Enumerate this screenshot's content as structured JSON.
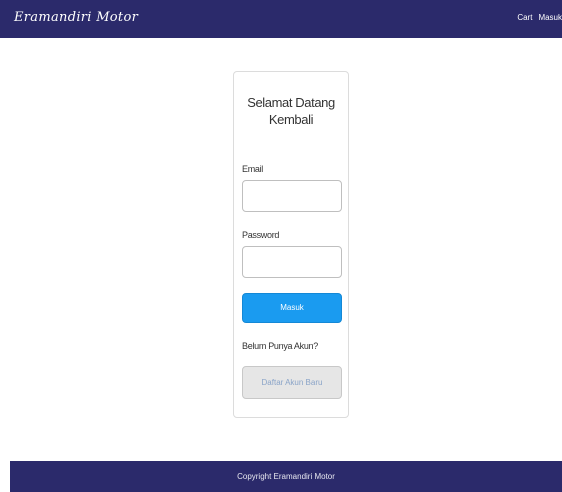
{
  "navbar": {
    "brand": "Eramandiri Motor",
    "links": [
      "Cart",
      "Masuk"
    ]
  },
  "login": {
    "title_line1": "Selamat Datang",
    "title_line2": "Kembali",
    "email_label": "Email",
    "email_value": "",
    "password_label": "Password",
    "password_value": "",
    "submit_label": "Masuk",
    "signup_question": "Belum Punya Akun?",
    "signup_label": "Daftar Akun Baru"
  },
  "footer": {
    "copyright": "Copyright Eramandiri Motor"
  },
  "colors": {
    "navbar_bg": "#2b2a6b",
    "primary_button": "#1a9bf0",
    "secondary_button": "#e6e6e6"
  }
}
